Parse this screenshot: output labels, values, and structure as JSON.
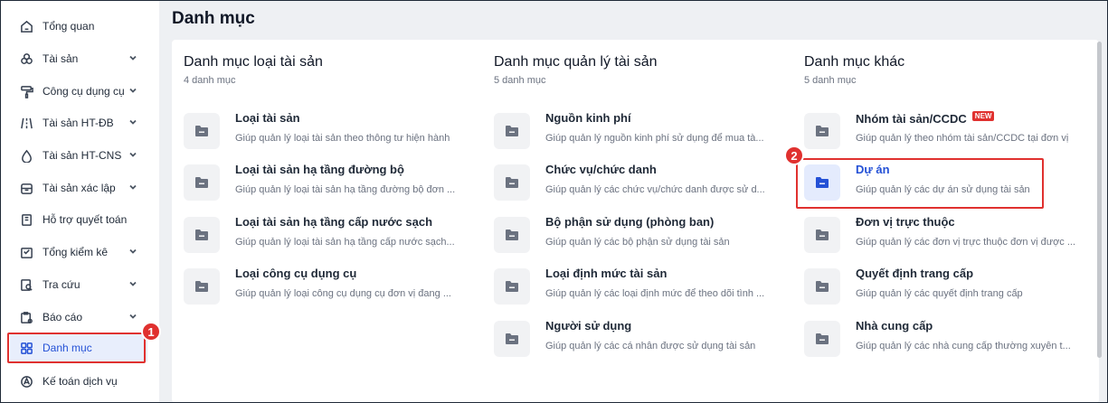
{
  "sidebar": {
    "items": [
      {
        "label": "Tổng quan",
        "icon": "home-icon",
        "chevron": false
      },
      {
        "label": "Tài sản",
        "icon": "cubes-icon",
        "chevron": true
      },
      {
        "label": "Công cụ dụng cụ",
        "icon": "paint-roller-icon",
        "chevron": true
      },
      {
        "label": "Tài sản HT-ĐB",
        "icon": "road-icon",
        "chevron": true
      },
      {
        "label": "Tài sản HT-CNS",
        "icon": "water-drop-icon",
        "chevron": true
      },
      {
        "label": "Tài sản xác lập",
        "icon": "archive-icon",
        "chevron": true
      },
      {
        "label": "Hỗ trợ quyết toán",
        "icon": "clipboard-icon",
        "chevron": false
      },
      {
        "label": "Tổng kiểm kê",
        "icon": "inventory-icon",
        "chevron": true
      },
      {
        "label": "Tra cứu",
        "icon": "search-doc-icon",
        "chevron": true
      },
      {
        "label": "Báo cáo",
        "icon": "report-icon",
        "chevron": true
      },
      {
        "label": "Danh mục",
        "icon": "grid-icon",
        "chevron": false,
        "active": true
      },
      {
        "label": "Kế toán dịch vụ",
        "icon": "accounting-icon",
        "chevron": false
      }
    ]
  },
  "annotations": {
    "badge1": "1",
    "badge2": "2",
    "highlight_color": "#e0312f"
  },
  "page": {
    "title": "Danh mục"
  },
  "columns": [
    {
      "title": "Danh mục loại tài sản",
      "count": "4 danh mục",
      "items": [
        {
          "name": "Loại tài sản",
          "desc": "Giúp quản lý loại tài sản theo thông tư hiện hành"
        },
        {
          "name": "Loại tài sản hạ tầng đường bộ",
          "desc": "Giúp quản lý loại tài sản hạ tầng đường bộ đơn ..."
        },
        {
          "name": "Loại tài sản hạ tầng cấp nước sạch",
          "desc": "Giúp quản lý loại tài sản hạ tầng cấp nước sạch..."
        },
        {
          "name": "Loại công cụ dụng cụ",
          "desc": "Giúp quản lý loại công cụ dụng cụ đơn vị đang ..."
        }
      ]
    },
    {
      "title": "Danh mục quản lý tài sản",
      "count": "5 danh mục",
      "items": [
        {
          "name": "Nguồn kinh phí",
          "desc": "Giúp quản lý nguồn kinh phí sử dụng để mua tà..."
        },
        {
          "name": "Chức vụ/chức danh",
          "desc": "Giúp quản lý các chức vụ/chức danh được sử d..."
        },
        {
          "name": "Bộ phận sử dụng (phòng ban)",
          "desc": "Giúp quản lý các bộ phận sử dụng tài sản"
        },
        {
          "name": "Loại định mức tài sản",
          "desc": "Giúp quản lý các loại định mức để theo dõi tình ..."
        },
        {
          "name": "Người sử dụng",
          "desc": "Giúp quản lý các cá nhân được sử dụng tài sản"
        }
      ]
    },
    {
      "title": "Danh mục khác",
      "count": "5 danh mục",
      "items": [
        {
          "name": "Nhóm tài sản/CCDC",
          "desc": "Giúp quản lý theo nhóm tài sản/CCDC tại đơn vị",
          "badge": "NEW"
        },
        {
          "name": "Dự án",
          "desc": "Giúp quản lý các dự án sử dụng tài sản",
          "active": true
        },
        {
          "name": "Đơn vị trực thuộc",
          "desc": "Giúp quản lý các đơn vị trực thuộc đơn vị được ..."
        },
        {
          "name": "Quyết định trang cấp",
          "desc": "Giúp quản lý các quyết định trang cấp"
        },
        {
          "name": "Nhà cung cấp",
          "desc": "Giúp quản lý các nhà cung cấp thường xuyên t..."
        }
      ]
    }
  ],
  "colors": {
    "accent": "#2451d6",
    "active_bg": "#e8eefc",
    "annotation_red": "#e0312f"
  }
}
